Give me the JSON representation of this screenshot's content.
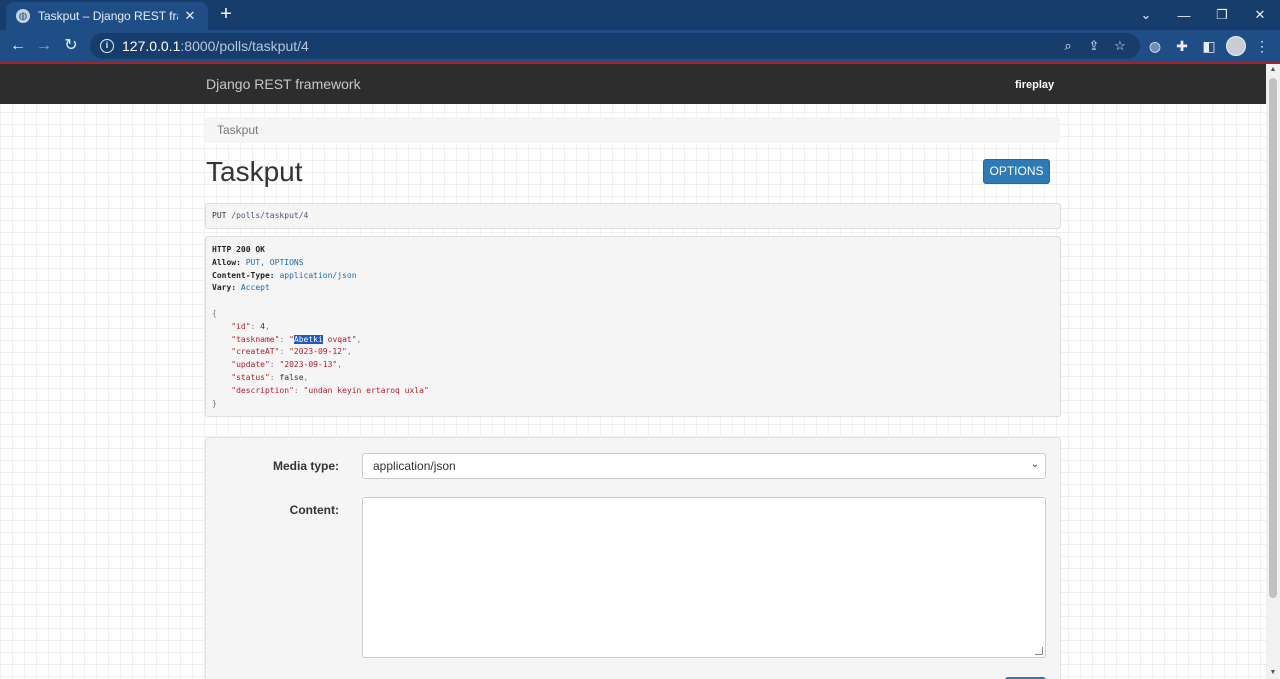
{
  "browser": {
    "tab_title": "Taskput – Django REST framewor",
    "url_host": "127.0.0.1",
    "url_path": ":8000/polls/taskput/4"
  },
  "navbar": {
    "brand": "Django REST framework",
    "user": "fireplay"
  },
  "breadcrumb": "Taskput",
  "page_title": "Taskput",
  "options_label": "OPTIONS",
  "request": {
    "method": "PUT",
    "path": " /polls/taskput/4"
  },
  "response": {
    "status": "HTTP 200 OK",
    "allow_name": "Allow:",
    "allow_value": " PUT, OPTIONS",
    "ctype_name": "Content-Type:",
    "ctype_value": " application/json",
    "vary_name": "Vary:",
    "vary_value": " Accept",
    "open_brace": "{",
    "close_brace": "}",
    "id_key": "\"id\"",
    "id_val": "4",
    "taskname_key": "\"taskname\"",
    "taskname_quote": "\"",
    "taskname_selected": "Abetki",
    "taskname_rest": " ovqat\"",
    "createAT_key": "\"createAT\"",
    "createAT_val": "\"2023-09-12\"",
    "update_key": "\"update\"",
    "update_val": "\"2023-09-13\"",
    "status_key": "\"status\"",
    "status_val": "false",
    "description_key": "\"description\"",
    "description_val": "\"undan keyin ertaroq uxla\""
  },
  "form": {
    "media_type_label": "Media type:",
    "media_type_value": "application/json",
    "content_label": "Content:"
  }
}
